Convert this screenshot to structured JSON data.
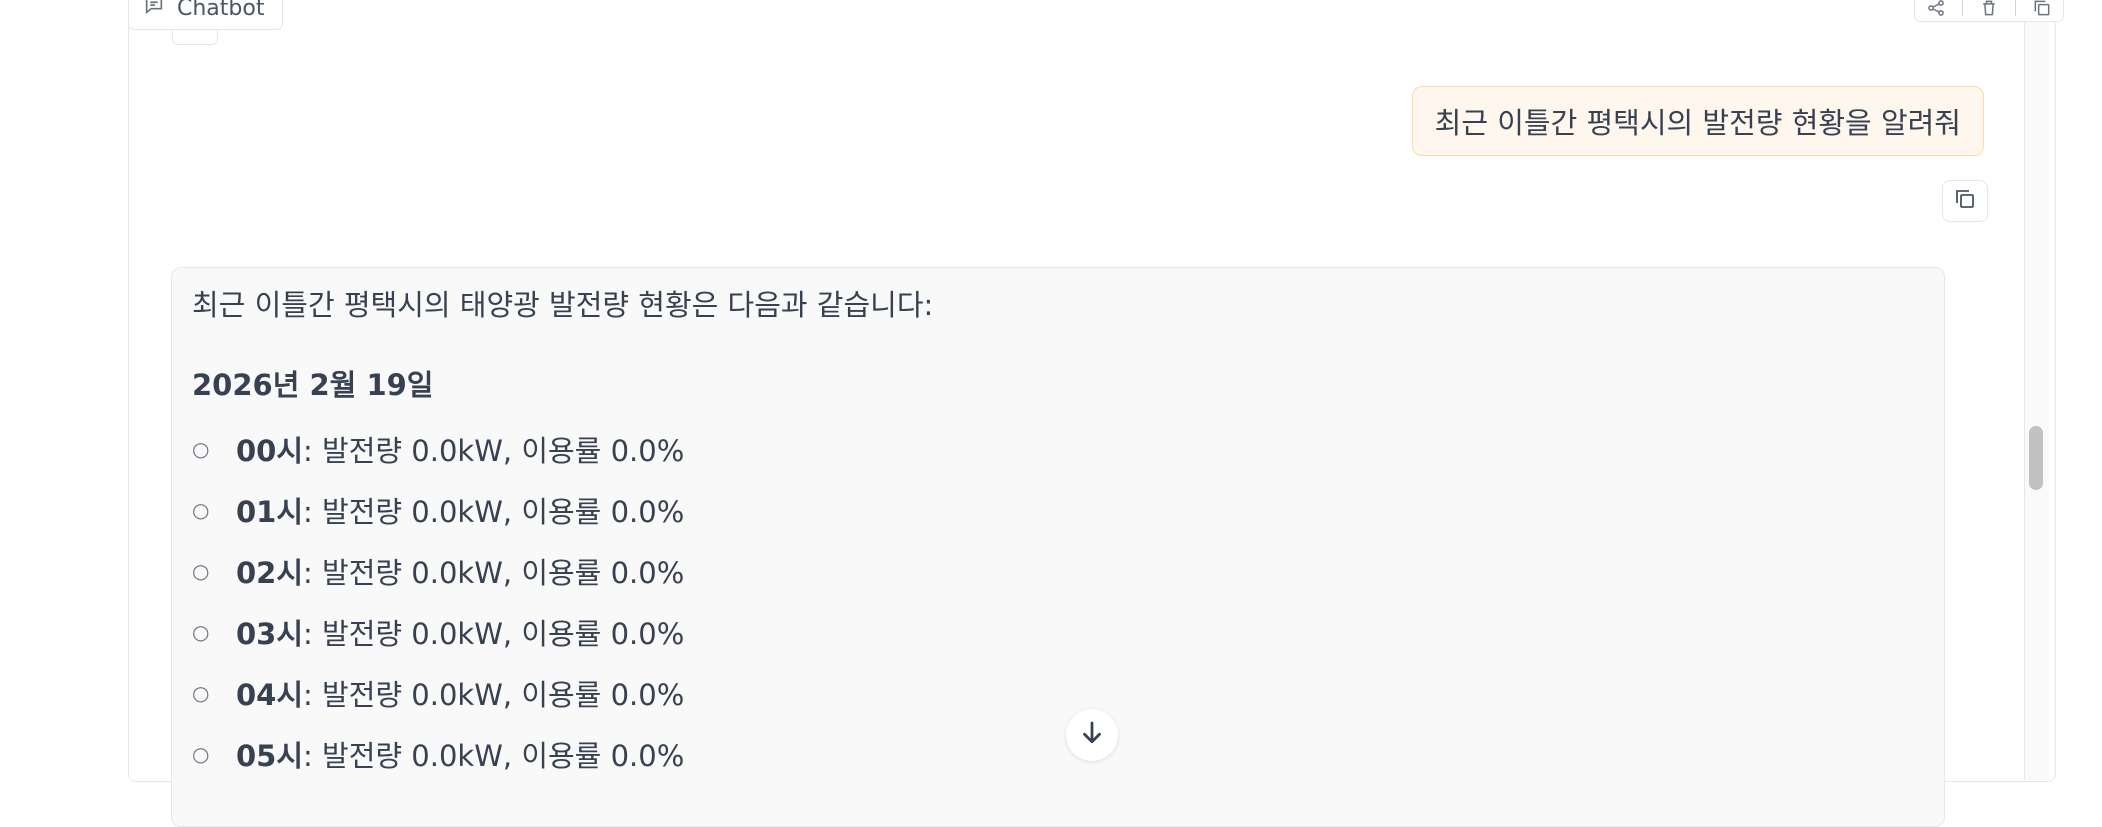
{
  "chatbot": {
    "label": "Chatbot",
    "icons": {
      "label_icon": "chat-icon",
      "share": "share-icon",
      "delete": "trash-icon",
      "copy_all": "copy-icon"
    }
  },
  "messages": {
    "user": {
      "text": "최근 이틀간 평택시의 발전량 현황을 알려줘"
    },
    "bot": {
      "intro": "최근 이틀간 평택시의 태양광 발전량 현황은 다음과 같습니다:",
      "date_heading": "2026년 2월 19일",
      "hours": [
        {
          "hour": "00시",
          "detail": ": 발전량 0.0kW, 이용률 0.0%"
        },
        {
          "hour": "01시",
          "detail": ": 발전량 0.0kW, 이용률 0.0%"
        },
        {
          "hour": "02시",
          "detail": ": 발전량 0.0kW, 이용률 0.0%"
        },
        {
          "hour": "03시",
          "detail": ": 발전량 0.0kW, 이용률 0.0%"
        },
        {
          "hour": "04시",
          "detail": ": 발전량 0.0kW, 이용률 0.0%"
        },
        {
          "hour": "05시",
          "detail": ": 발전량 0.0kW, 이용률 0.0%"
        }
      ],
      "bullet": "○"
    }
  },
  "controls": {
    "scroll_down_icon": "arrow-down-icon"
  },
  "colors": {
    "user_bubble_bg": "#fff7ed",
    "user_bubble_border": "#fcd9a8",
    "bot_bubble_bg": "#f9f9f9"
  }
}
